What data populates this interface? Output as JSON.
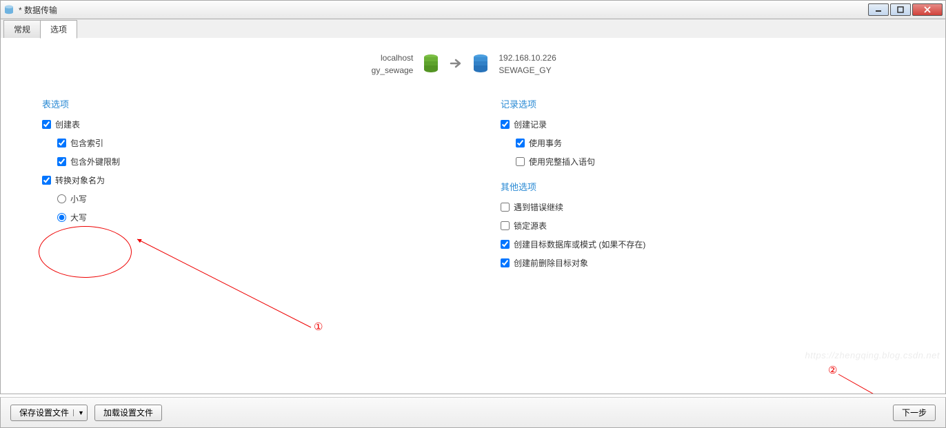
{
  "window": {
    "title": "* 数据传输"
  },
  "tabs": [
    {
      "label": "常规",
      "active": false
    },
    {
      "label": "选项",
      "active": true
    }
  ],
  "transfer": {
    "source": {
      "host": "localhost",
      "db": "gy_sewage"
    },
    "target": {
      "host": "192.168.10.226",
      "db": "SEWAGE_GY"
    }
  },
  "table_options": {
    "title": "表选项",
    "create_tables": {
      "label": "创建表",
      "checked": true
    },
    "include_indexes": {
      "label": "包含索引",
      "checked": true
    },
    "include_fk": {
      "label": "包含外键限制",
      "checked": true
    },
    "convert_names": {
      "label": "转换对象名为",
      "checked": true
    },
    "case_lower": {
      "label": "小写"
    },
    "case_upper": {
      "label": "大写"
    },
    "case_selected": "upper"
  },
  "record_options": {
    "title": "记录选项",
    "create_records": {
      "label": "创建记录",
      "checked": true
    },
    "use_tx": {
      "label": "使用事务",
      "checked": true
    },
    "full_insert": {
      "label": "使用完整插入语句",
      "checked": false
    }
  },
  "other_options": {
    "title": "其他选项",
    "continue_on_err": {
      "label": "遇到错误继续",
      "checked": false
    },
    "lock_source": {
      "label": "锁定源表",
      "checked": false
    },
    "create_target_schema": {
      "label": "创建目标数据库或模式 (如果不存在)",
      "checked": true
    },
    "drop_target_first": {
      "label": "创建前删除目标对象",
      "checked": true
    }
  },
  "footer": {
    "save_profile": "保存设置文件",
    "load_profile": "加载设置文件",
    "next": "下一步"
  },
  "annotations": {
    "n1": "①",
    "n2": "②"
  },
  "watermark": "https://zhengqing.blog.csdn.net"
}
